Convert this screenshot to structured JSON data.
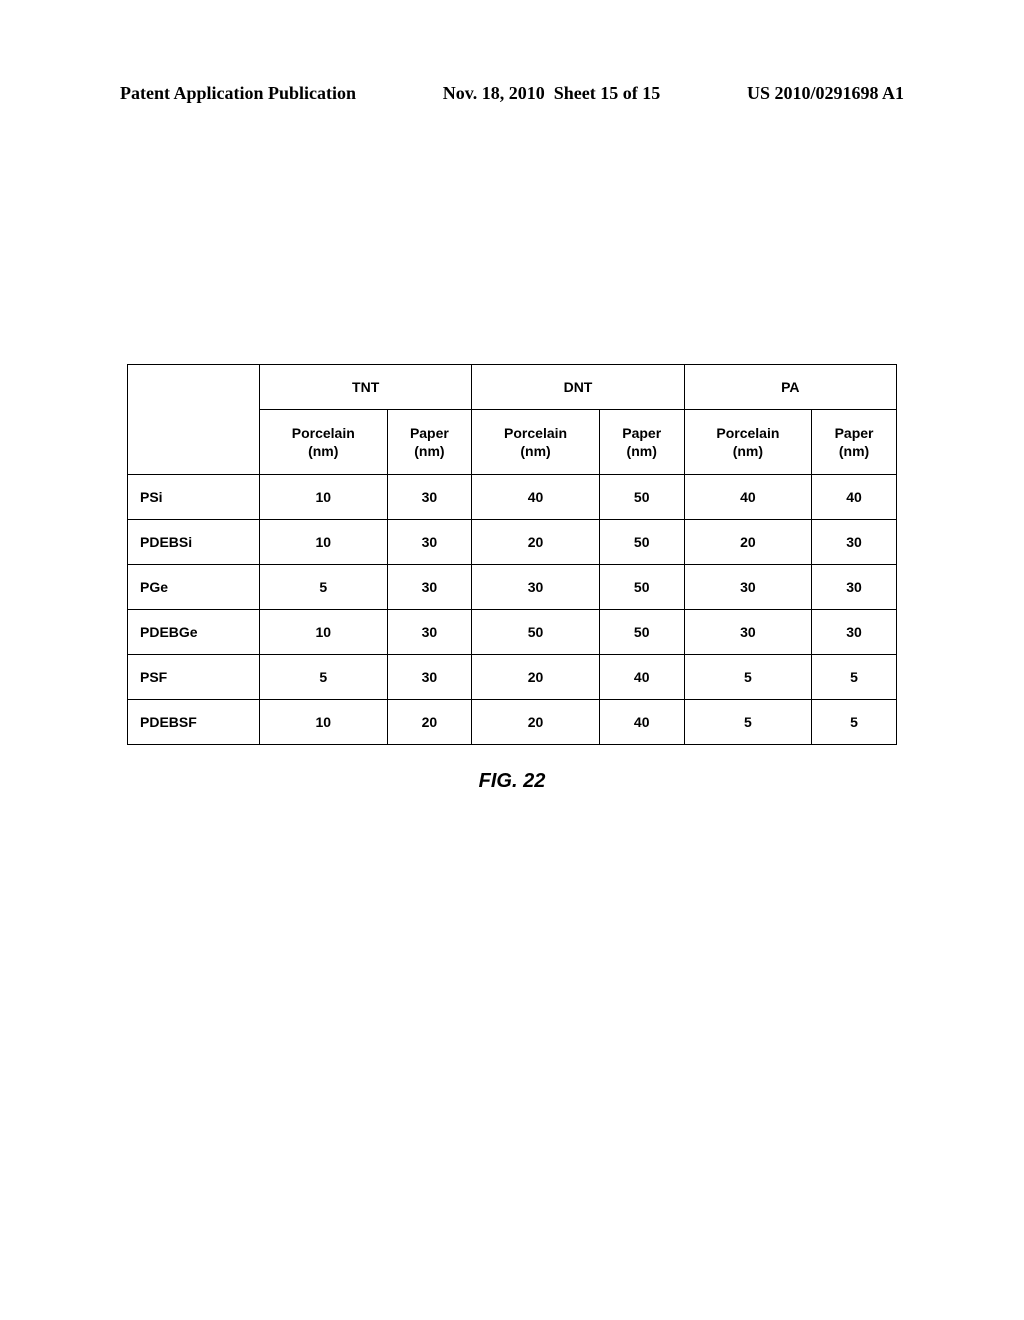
{
  "header": {
    "left": "Patent Application Publication",
    "date": "Nov. 18, 2010",
    "sheet": "Sheet 15 of 15",
    "right": "US 2010/0291698 A1"
  },
  "chart_data": {
    "type": "table",
    "title": "FIG. 22",
    "group_headers": [
      "TNT",
      "DNT",
      "PA"
    ],
    "sub_headers": [
      "Porcelain\n(nm)",
      "Paper\n(nm)",
      "Porcelain\n(nm)",
      "Paper\n(nm)",
      "Porcelain\n(nm)",
      "Paper\n(nm)"
    ],
    "rows": [
      {
        "label": "PSi",
        "values": [
          10,
          30,
          40,
          50,
          40,
          40
        ]
      },
      {
        "label": "PDEBSi",
        "values": [
          10,
          30,
          20,
          50,
          20,
          30
        ]
      },
      {
        "label": "PGe",
        "values": [
          5,
          30,
          30,
          50,
          30,
          30
        ]
      },
      {
        "label": "PDEBGe",
        "values": [
          10,
          30,
          50,
          50,
          30,
          30
        ]
      },
      {
        "label": "PSF",
        "values": [
          5,
          30,
          20,
          40,
          5,
          5
        ]
      },
      {
        "label": "PDEBSF",
        "values": [
          10,
          20,
          20,
          40,
          5,
          5
        ]
      }
    ]
  },
  "caption": "FIG. 22"
}
